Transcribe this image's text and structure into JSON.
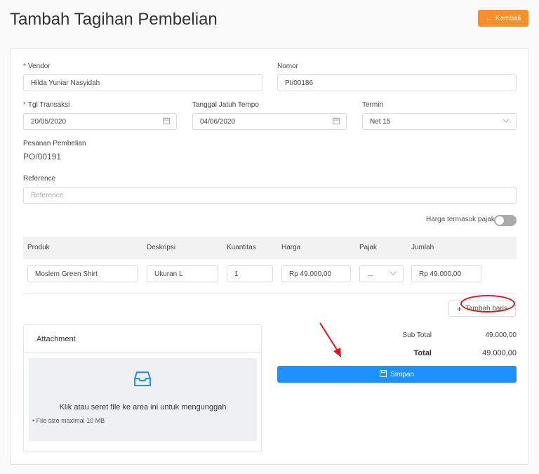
{
  "page": {
    "title": "Tambah Tagihan Pembelian",
    "back_label": "Kembali"
  },
  "form": {
    "vendor": {
      "label": "Vendor",
      "value": "Hilda Yuniar Nasyidah"
    },
    "nomor": {
      "label": "Nomor",
      "value": "PI/00186"
    },
    "tgl_transaksi": {
      "label": "Tgl Transaksi",
      "value": "20/05/2020"
    },
    "jatuh_tempo": {
      "label": "Tanggal Jatuh Tempo",
      "value": "04/06/2020"
    },
    "termin": {
      "label": "Termin",
      "value": "Net 15"
    },
    "pesanan": {
      "label": "Pesanan Pembelian",
      "value": "PO/00191"
    },
    "reference": {
      "label": "Reference",
      "placeholder": "Reference"
    },
    "harga_pajak_label": "Harga termasuk pajak"
  },
  "table": {
    "headers": {
      "produk": "Produk",
      "deskripsi": "Deskripsi",
      "kuantitas": "Kuantitas",
      "harga": "Harga",
      "pajak": "Pajak",
      "jumlah": "Jumlah"
    },
    "row": {
      "produk": "Moslem Green Shirt",
      "deskripsi": "Ukuran L",
      "kuantitas": "1",
      "harga": "Rp 49.000,00",
      "pajak": "...",
      "jumlah": "Rp 49.000,00"
    },
    "add_row_label": "Tambah baris"
  },
  "attachment": {
    "title": "Attachment",
    "drop_text": "Klik atau seret file ke area ini untuk mengunggah",
    "note": "File size maximal 10 MB"
  },
  "totals": {
    "subtotal_label": "Sub Total",
    "subtotal_value": "49.000,00",
    "total_label": "Total",
    "total_value": "49.000,00"
  },
  "save_label": "Simpan",
  "colors": {
    "accent": "#1e90ff",
    "back": "#f6902a",
    "required": "#e53935",
    "annotation": "#e2141b"
  }
}
